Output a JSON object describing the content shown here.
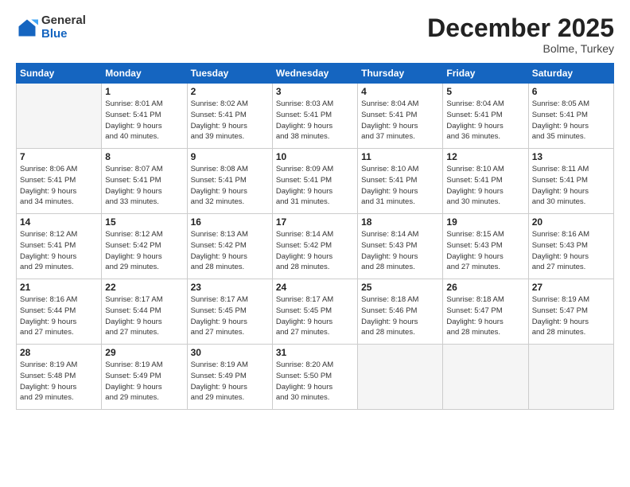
{
  "logo": {
    "general": "General",
    "blue": "Blue"
  },
  "header": {
    "month": "December 2025",
    "location": "Bolme, Turkey"
  },
  "weekdays": [
    "Sunday",
    "Monday",
    "Tuesday",
    "Wednesday",
    "Thursday",
    "Friday",
    "Saturday"
  ],
  "weeks": [
    [
      {
        "day": "",
        "info": ""
      },
      {
        "day": "1",
        "info": "Sunrise: 8:01 AM\nSunset: 5:41 PM\nDaylight: 9 hours\nand 40 minutes."
      },
      {
        "day": "2",
        "info": "Sunrise: 8:02 AM\nSunset: 5:41 PM\nDaylight: 9 hours\nand 39 minutes."
      },
      {
        "day": "3",
        "info": "Sunrise: 8:03 AM\nSunset: 5:41 PM\nDaylight: 9 hours\nand 38 minutes."
      },
      {
        "day": "4",
        "info": "Sunrise: 8:04 AM\nSunset: 5:41 PM\nDaylight: 9 hours\nand 37 minutes."
      },
      {
        "day": "5",
        "info": "Sunrise: 8:04 AM\nSunset: 5:41 PM\nDaylight: 9 hours\nand 36 minutes."
      },
      {
        "day": "6",
        "info": "Sunrise: 8:05 AM\nSunset: 5:41 PM\nDaylight: 9 hours\nand 35 minutes."
      }
    ],
    [
      {
        "day": "7",
        "info": "Sunrise: 8:06 AM\nSunset: 5:41 PM\nDaylight: 9 hours\nand 34 minutes."
      },
      {
        "day": "8",
        "info": "Sunrise: 8:07 AM\nSunset: 5:41 PM\nDaylight: 9 hours\nand 33 minutes."
      },
      {
        "day": "9",
        "info": "Sunrise: 8:08 AM\nSunset: 5:41 PM\nDaylight: 9 hours\nand 32 minutes."
      },
      {
        "day": "10",
        "info": "Sunrise: 8:09 AM\nSunset: 5:41 PM\nDaylight: 9 hours\nand 31 minutes."
      },
      {
        "day": "11",
        "info": "Sunrise: 8:10 AM\nSunset: 5:41 PM\nDaylight: 9 hours\nand 31 minutes."
      },
      {
        "day": "12",
        "info": "Sunrise: 8:10 AM\nSunset: 5:41 PM\nDaylight: 9 hours\nand 30 minutes."
      },
      {
        "day": "13",
        "info": "Sunrise: 8:11 AM\nSunset: 5:41 PM\nDaylight: 9 hours\nand 30 minutes."
      }
    ],
    [
      {
        "day": "14",
        "info": "Sunrise: 8:12 AM\nSunset: 5:41 PM\nDaylight: 9 hours\nand 29 minutes."
      },
      {
        "day": "15",
        "info": "Sunrise: 8:12 AM\nSunset: 5:42 PM\nDaylight: 9 hours\nand 29 minutes."
      },
      {
        "day": "16",
        "info": "Sunrise: 8:13 AM\nSunset: 5:42 PM\nDaylight: 9 hours\nand 28 minutes."
      },
      {
        "day": "17",
        "info": "Sunrise: 8:14 AM\nSunset: 5:42 PM\nDaylight: 9 hours\nand 28 minutes."
      },
      {
        "day": "18",
        "info": "Sunrise: 8:14 AM\nSunset: 5:43 PM\nDaylight: 9 hours\nand 28 minutes."
      },
      {
        "day": "19",
        "info": "Sunrise: 8:15 AM\nSunset: 5:43 PM\nDaylight: 9 hours\nand 27 minutes."
      },
      {
        "day": "20",
        "info": "Sunrise: 8:16 AM\nSunset: 5:43 PM\nDaylight: 9 hours\nand 27 minutes."
      }
    ],
    [
      {
        "day": "21",
        "info": "Sunrise: 8:16 AM\nSunset: 5:44 PM\nDaylight: 9 hours\nand 27 minutes."
      },
      {
        "day": "22",
        "info": "Sunrise: 8:17 AM\nSunset: 5:44 PM\nDaylight: 9 hours\nand 27 minutes."
      },
      {
        "day": "23",
        "info": "Sunrise: 8:17 AM\nSunset: 5:45 PM\nDaylight: 9 hours\nand 27 minutes."
      },
      {
        "day": "24",
        "info": "Sunrise: 8:17 AM\nSunset: 5:45 PM\nDaylight: 9 hours\nand 27 minutes."
      },
      {
        "day": "25",
        "info": "Sunrise: 8:18 AM\nSunset: 5:46 PM\nDaylight: 9 hours\nand 28 minutes."
      },
      {
        "day": "26",
        "info": "Sunrise: 8:18 AM\nSunset: 5:47 PM\nDaylight: 9 hours\nand 28 minutes."
      },
      {
        "day": "27",
        "info": "Sunrise: 8:19 AM\nSunset: 5:47 PM\nDaylight: 9 hours\nand 28 minutes."
      }
    ],
    [
      {
        "day": "28",
        "info": "Sunrise: 8:19 AM\nSunset: 5:48 PM\nDaylight: 9 hours\nand 29 minutes."
      },
      {
        "day": "29",
        "info": "Sunrise: 8:19 AM\nSunset: 5:49 PM\nDaylight: 9 hours\nand 29 minutes."
      },
      {
        "day": "30",
        "info": "Sunrise: 8:19 AM\nSunset: 5:49 PM\nDaylight: 9 hours\nand 29 minutes."
      },
      {
        "day": "31",
        "info": "Sunrise: 8:20 AM\nSunset: 5:50 PM\nDaylight: 9 hours\nand 30 minutes."
      },
      {
        "day": "",
        "info": ""
      },
      {
        "day": "",
        "info": ""
      },
      {
        "day": "",
        "info": ""
      }
    ]
  ]
}
